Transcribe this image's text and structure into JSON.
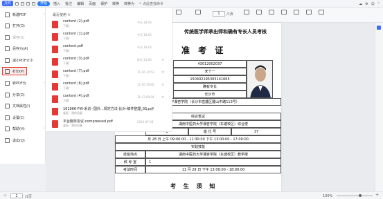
{
  "topbar": {
    "file_label": "文件",
    "start_label": "开始",
    "tabs": [
      "插入",
      "批注",
      "编辑",
      "页面",
      "保护",
      "转换",
      "转换为"
    ],
    "search_placeholder": "点此查找命令"
  },
  "ribbon": {
    "page_current": "1",
    "page_total": "/1页",
    "items": [
      "拆分合并",
      "打印",
      "旋转",
      "高亮",
      "放映",
      "截图",
      "阅读",
      "单页",
      "双页",
      "连续阅读",
      "智能目录"
    ]
  },
  "file_menu": {
    "items": [
      {
        "label": "新建PDF",
        "selected": false
      },
      {
        "label": "打开(O)",
        "selected": false
      },
      {
        "label": "保存(S)",
        "selected": false
      },
      {
        "label": "另存为(A)",
        "selected": false
      },
      {
        "label": "减小PDF大小",
        "selected": false
      },
      {
        "label": "打印(P)",
        "selected": true
      },
      {
        "label": "转PDF为",
        "selected": false
      },
      {
        "label": "分享(D)",
        "selected": false
      },
      {
        "label": "文档属性(I)",
        "selected": false
      },
      {
        "label": "设置(C)",
        "selected": false
      },
      {
        "label": "帮助(H)",
        "selected": false
      },
      {
        "label": "退出(Q)",
        "selected": false
      }
    ]
  },
  "recent": {
    "heading": "最近使用",
    "files": [
      {
        "name": "content (2).pdf",
        "sub": "下载/",
        "time": "今天 18:03"
      },
      {
        "name": "content (1).pdf",
        "sub": "下载/",
        "time": "今天 18:03"
      },
      {
        "name": "content.pdf",
        "sub": "下载/",
        "time": "今天 18:03"
      },
      {
        "name": "content (3).pdf",
        "sub": "下载/",
        "time": "昨天 21:03"
      },
      {
        "name": "content (7).pdf",
        "sub": "下载/",
        "time": "11-16 14:53"
      },
      {
        "name": "content (6).pdf",
        "sub": "下载/",
        "time": "11-16 19:02"
      },
      {
        "name": "content (4).pdf",
        "sub": "下载/",
        "time": "11-13 09:04"
      },
      {
        "name": "161966-FW-采访--国外...规定方法-比对-稿件整理_0S.pdf",
        "sub": "桌面 · 我的设备",
        "time": "2019-08-16"
      },
      {
        "name": "平台服务协议-compressed.pdf",
        "sub": "桌面 · 我的设备",
        "time": "2019-07-08"
      }
    ]
  },
  "document": {
    "header_title": "传统医学师承出师和确有专长人员考核",
    "main_title": "准 考 证",
    "fields": [
      {
        "label": "",
        "value": "43012002037"
      },
      {
        "label": "",
        "value": "宋十一"
      },
      {
        "label": "",
        "value": "150402195305141665"
      },
      {
        "label": "",
        "value": "确有专长"
      },
      {
        "label": "",
        "value": "长沙市"
      }
    ],
    "addr_row": "中医药大学湘杏学院（长沙市岳麓区麓山中路113号）",
    "section1": "综合笔试",
    "s1_place": "湖南中医药大学湘杏学院（东塘校区）综合楼",
    "s1_room": "1",
    "s1_seat_label": "座 位 号",
    "s1_seat": "37",
    "s1_time": "月 28 日 上午 09:00:00 - 11:30:00  下午 13:00:00 - 17:00:00",
    "section2": "实践技能",
    "s2_place_label": "技能地点",
    "s2_place": "湖南中医药大学湘杏学院（东塘校区）教学楼",
    "s2_room_label": "候 考 室",
    "s2_room": "1",
    "s2_time_label": "考试时间",
    "s2_time": "11 月 29 日  下午 13:00:00 - 18:00:00",
    "notice": "考 生 须 知"
  },
  "statusbar": {
    "page_current": "1",
    "page_total": "/1页",
    "zoom": "100%"
  }
}
